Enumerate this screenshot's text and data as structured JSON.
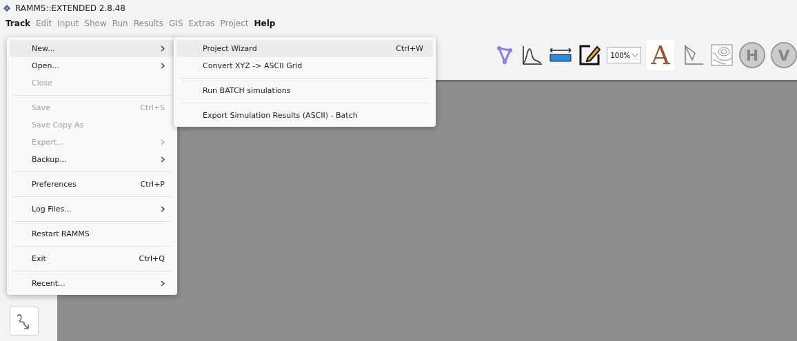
{
  "window": {
    "title": "RAMMS::EXTENDED 2.8.48"
  },
  "menubar": [
    {
      "label": "Track",
      "selected": true
    },
    {
      "label": "Edit",
      "selected": false
    },
    {
      "label": "Input",
      "selected": false
    },
    {
      "label": "Show",
      "selected": false
    },
    {
      "label": "Run",
      "selected": false
    },
    {
      "label": "Results",
      "selected": false
    },
    {
      "label": "GIS",
      "selected": false
    },
    {
      "label": "Extras",
      "selected": false
    },
    {
      "label": "Project",
      "selected": false
    },
    {
      "label": "Help",
      "selected": true
    }
  ],
  "menu": [
    {
      "label": "New...",
      "submenu": true,
      "disabled": false,
      "selected": true
    },
    {
      "label": "Open...",
      "submenu": true,
      "disabled": false,
      "selected": false
    },
    {
      "label": "Close",
      "disabled": true,
      "selected": false,
      "separator_after": true
    },
    {
      "label": "Save",
      "shortcut": "Ctrl+S",
      "disabled": true,
      "selected": false
    },
    {
      "label": "Save Copy As",
      "disabled": true,
      "selected": false
    },
    {
      "label": "Export...",
      "submenu": true,
      "disabled": true,
      "selected": false
    },
    {
      "label": "Backup...",
      "submenu": true,
      "disabled": false,
      "selected": false,
      "separator_after": true
    },
    {
      "label": "Preferences",
      "shortcut": "Ctrl+P",
      "disabled": false,
      "selected": false,
      "separator_after": true
    },
    {
      "label": "Log Files...",
      "submenu": true,
      "disabled": false,
      "selected": false,
      "separator_after": true
    },
    {
      "label": "Restart RAMMS",
      "disabled": false,
      "selected": false,
      "separator_after": true
    },
    {
      "label": "Exit",
      "shortcut": "Ctrl+Q",
      "disabled": false,
      "selected": false,
      "separator_after": true
    },
    {
      "label": "Recent...",
      "submenu": true,
      "disabled": false,
      "selected": false
    }
  ],
  "submenu": [
    {
      "label": "Project Wizard",
      "shortcut": "Ctrl+W",
      "selected": true
    },
    {
      "label": "Convert XYZ -> ASCII Grid",
      "selected": false,
      "separator_after": true
    },
    {
      "label": "Run BATCH simulations",
      "selected": false,
      "separator_after": true
    },
    {
      "label": "Export Simulation Results (ASCII) - Batch",
      "selected": false
    }
  ],
  "toolbar": [
    {
      "kind": "polygon"
    },
    {
      "kind": "profile"
    },
    {
      "kind": "ruler"
    },
    {
      "kind": "edit"
    },
    {
      "kind": "zoom",
      "value": "100%"
    },
    {
      "kind": "letter",
      "text": "A"
    },
    {
      "kind": "axes"
    },
    {
      "kind": "contour"
    },
    {
      "kind": "circle",
      "text": "H"
    },
    {
      "kind": "circle",
      "text": "V"
    }
  ]
}
